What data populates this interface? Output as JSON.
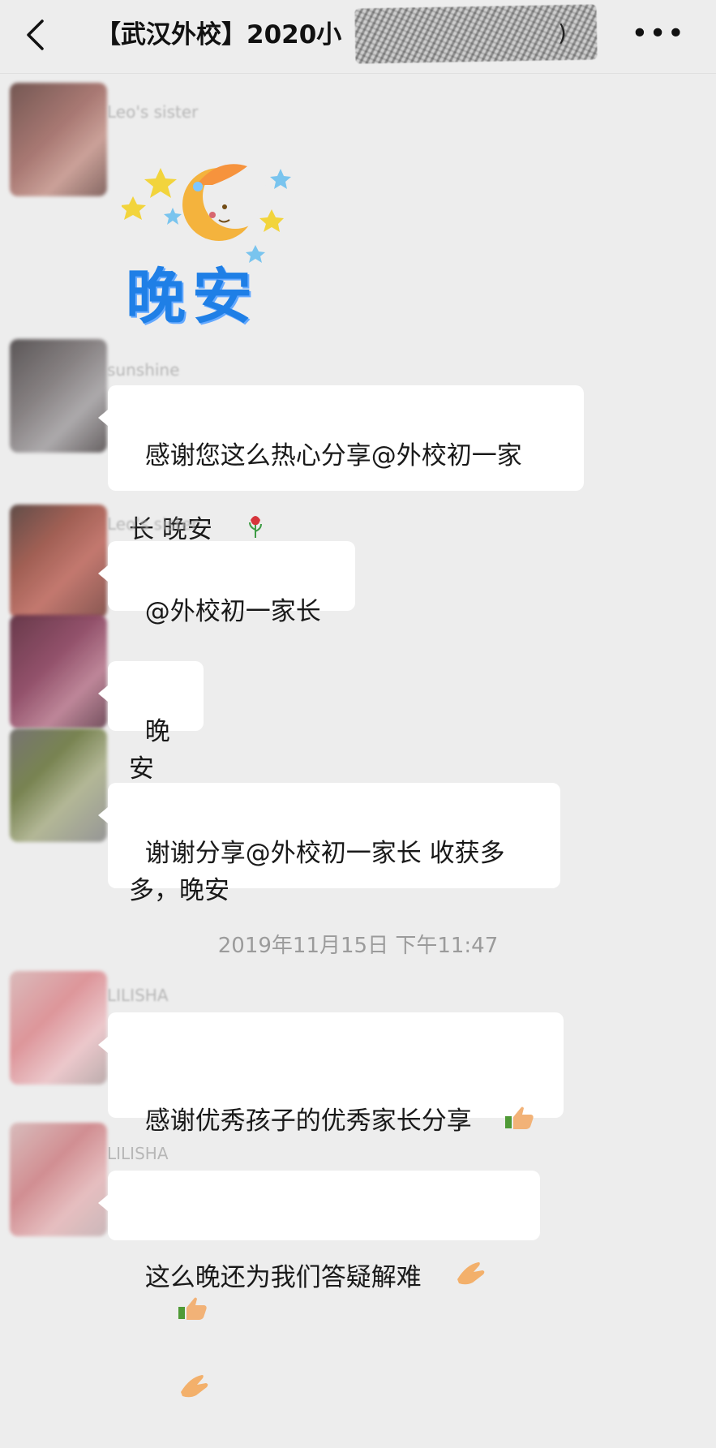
{
  "header": {
    "title": "【武汉外校】2020小",
    "title_tail": ")",
    "back_icon": "chevron-left-icon",
    "more_label": "•••"
  },
  "sticker": {
    "text": "晚安",
    "icon": "moon-stars-icon"
  },
  "messages": [
    {
      "sender": "Leo's sister",
      "type": "sticker"
    },
    {
      "sender": "sunshine",
      "text": "感谢您这么热心分享@外校初一家\n长 晚安",
      "emoji": "rose-icon"
    },
    {
      "sender": "Leo's sister",
      "text": "@外校初一家长"
    },
    {
      "sender": "",
      "text": "晚安"
    },
    {
      "sender": "",
      "text": "谢谢分享@外校初一家长 收获多\n多，晚安"
    },
    {
      "sender": "LILISHA",
      "text": "感谢优秀孩子的优秀家长分享",
      "emoji": "thumbs-up-icon"
    },
    {
      "sender": "LILISHA",
      "text": "这么晚还为我们答疑解难",
      "emoji": "clapping-hands-icon"
    }
  ],
  "timestamp": "2019年11月15日 下午11:47",
  "colors": {
    "background": "#ededed",
    "bubble": "#ffffff",
    "sticker_text": "#1f7fe6"
  }
}
